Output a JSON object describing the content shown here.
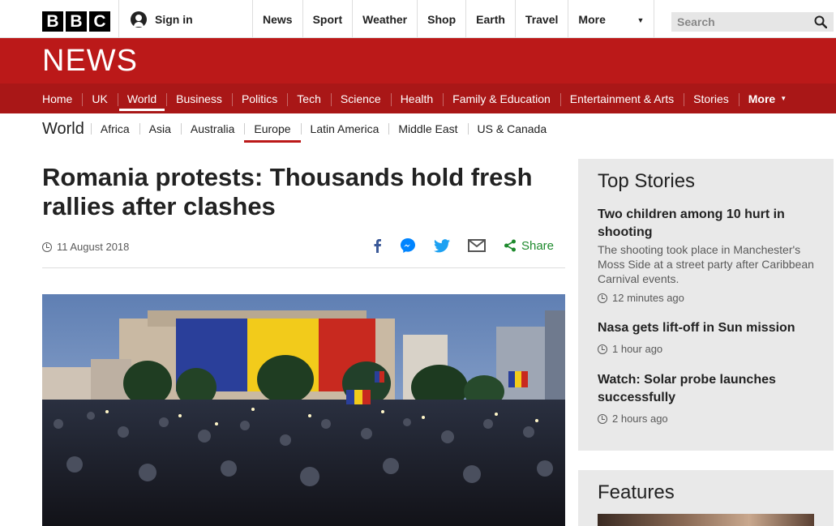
{
  "topbar": {
    "logo_letters": [
      "B",
      "B",
      "C"
    ],
    "signin_label": "Sign in",
    "nav": [
      "News",
      "Sport",
      "Weather",
      "Shop",
      "Earth",
      "Travel"
    ],
    "more_label": "More",
    "search_placeholder": "Search"
  },
  "brand": {
    "title": "NEWS",
    "band_color": "#bb1919"
  },
  "sections": [
    "Home",
    "UK",
    "World",
    "Business",
    "Politics",
    "Tech",
    "Science",
    "Health",
    "Family & Education",
    "Entertainment & Arts",
    "Stories"
  ],
  "sections_active": "World",
  "sections_more": "More",
  "subnav": {
    "title": "World",
    "items": [
      "Africa",
      "Asia",
      "Australia",
      "Europe",
      "Latin America",
      "Middle East",
      "US & Canada"
    ],
    "active": "Europe"
  },
  "article": {
    "headline": "Romania protests: Thousands hold fresh rallies after clashes",
    "date": "11 August 2018",
    "share_label": "Share"
  },
  "sidebar": {
    "top_stories_title": "Top Stories",
    "stories": [
      {
        "title": "Two children among 10 hurt in shooting",
        "summary": "The shooting took place in Manchester's Moss Side at a street party after Caribbean Carnival events.",
        "time": "12 minutes ago"
      },
      {
        "title": "Nasa gets lift-off in Sun mission",
        "summary": "",
        "time": "1 hour ago"
      },
      {
        "title": "Watch: Solar probe launches successfully",
        "summary": "",
        "time": "2 hours ago"
      }
    ],
    "features_title": "Features"
  }
}
